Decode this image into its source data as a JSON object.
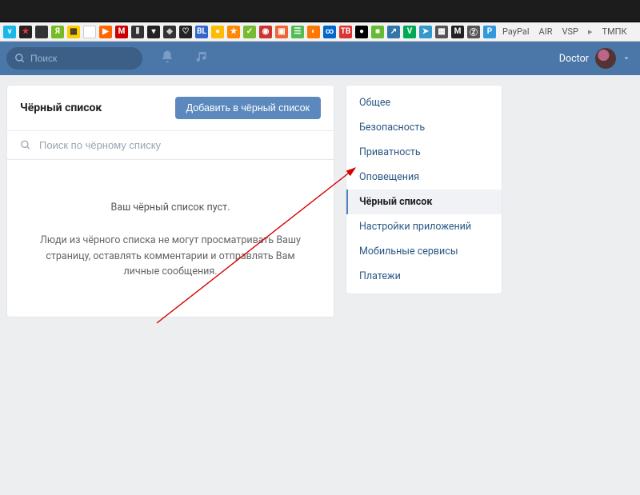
{
  "browser": {
    "ext_text_items": [
      "PayPal",
      "AIR",
      "VSP",
      "ТМПК"
    ]
  },
  "topnav": {
    "search_placeholder": "Поиск",
    "username": "Doctor"
  },
  "main": {
    "title": "Чёрный список",
    "add_button": "Добавить в чёрный список",
    "search_placeholder": "Поиск по чёрному списку",
    "empty_title": "Ваш чёрный список пуст.",
    "empty_desc": "Люди из чёрного списка не могут просматривать Вашу страницу, оставлять комментарии и отправлять Вам личные сообщения."
  },
  "sidebar": {
    "items": [
      {
        "label": "Общее"
      },
      {
        "label": "Безопасность"
      },
      {
        "label": "Приватность"
      },
      {
        "label": "Оповещения"
      },
      {
        "label": "Чёрный список",
        "active": true
      },
      {
        "label": "Настройки приложений"
      },
      {
        "label": "Мобильные сервисы"
      },
      {
        "label": "Платежи"
      }
    ]
  }
}
